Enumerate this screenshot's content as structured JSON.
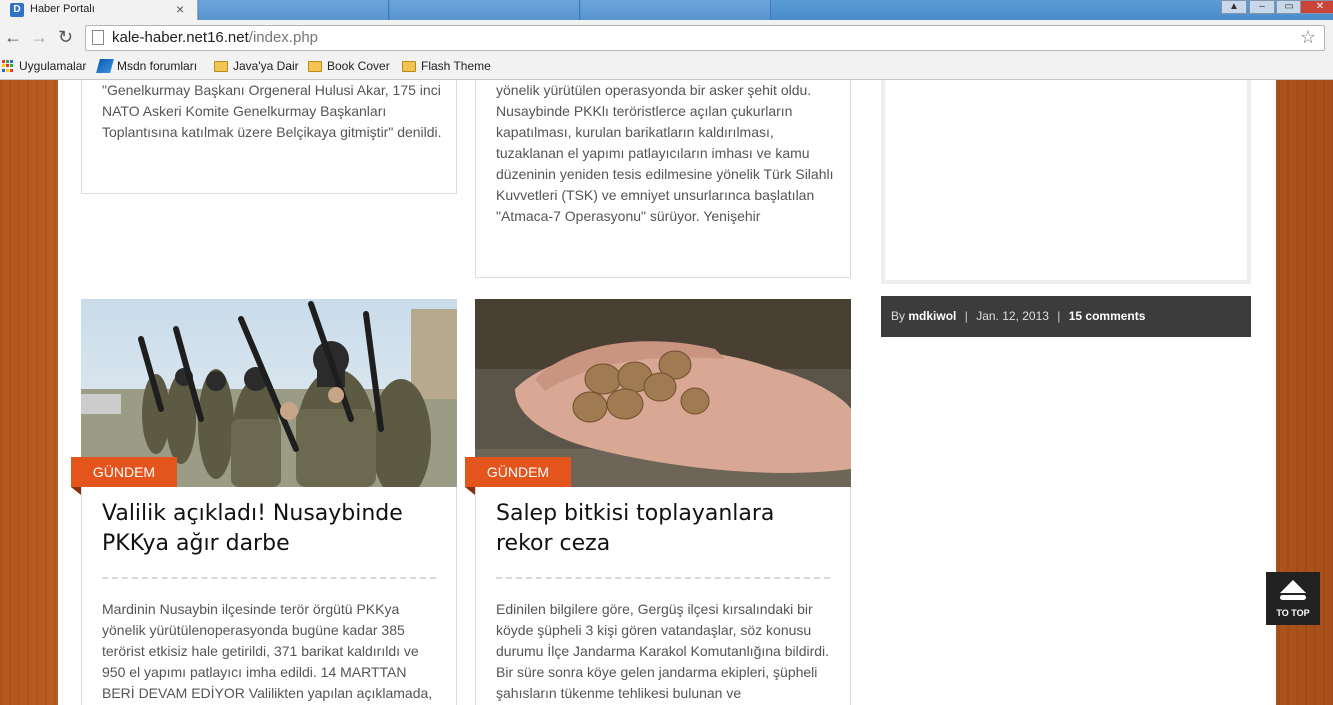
{
  "browser": {
    "tab_title": "Haber Portalı",
    "tab_favicon_letter": "D",
    "url_host": "kale-haber.net16.net",
    "url_path": "/index.php",
    "bookmarks": [
      {
        "label": "Uygulamalar",
        "icon": "apps-icon"
      },
      {
        "label": "Msdn forumları",
        "icon": "msdn-icon"
      },
      {
        "label": "Java'ya Dair",
        "icon": "folder-icon"
      },
      {
        "label": "Book Cover",
        "icon": "folder-icon"
      },
      {
        "label": "Flash Theme",
        "icon": "folder-icon"
      }
    ]
  },
  "posts_top": [
    {
      "text": "\"Genelkurmay Başkanı Orgeneral Hulusi Akar, 175 inci NATO Askeri Komite Genelkurmay Başkanları Toplantısına katılmak üzere Belçikaya gitmiştir\" denildi."
    },
    {
      "text": "yönelik yürütülen operasyonda bir asker şehit oldu. Nusaybinde PKKlı teröristlerce açılan çukurların kapatılması, kurulan barikatların kaldırılması, tuzaklanan el yapımı patlayıcıların imhası ve kamu düzeninin yeniden tesis edilmesine yönelik Türk Silahlı Kuvvetleri (TSK) ve emniyet unsurlarınca başlatılan \"Atmaca-7 Operasyonu\" sürüyor. Yenişehir"
    }
  ],
  "posts": [
    {
      "category": "GÜNDEM",
      "title": "Valilik açıkladı! Nusaybinde PKKya ağır darbe",
      "excerpt": "Mardinin Nusaybin ilçesinde terör örgütü PKKya yönelik yürütülenoperasyonda bugüne kadar 385 terörist etkisiz hale getirildi, 371 barikat kaldırıldı ve 950 el yapımı patlayıcı imha edildi. 14 MARTTAN BERİ DEVAM EDİYOR Valilikten yapılan açıklamada,"
    },
    {
      "category": "GÜNDEM",
      "title": "Salep bitkisi toplayanlara rekor ceza",
      "excerpt": "Edinilen bilgilere göre, Gergüş ilçesi kırsalındaki bir köyde şüpheli 3 kişi gören vatandaşlar, söz konusu durumu İlçe Jandarma Karakol Komutanlığına bildirdi. Bir süre sonra köye gelen jandarma ekipleri, şüpheli şahısların tükenme tehlikesi bulunan ve"
    }
  ],
  "meta": {
    "by_label": "By",
    "author": "mdkiwol",
    "date": "Jan. 12, 2013",
    "comments": "15 comments"
  },
  "to_top_label": "TO TOP",
  "colors": {
    "accent": "#e4541d",
    "meta_bar": "#3c3c3c",
    "wood": "#c2662a"
  }
}
